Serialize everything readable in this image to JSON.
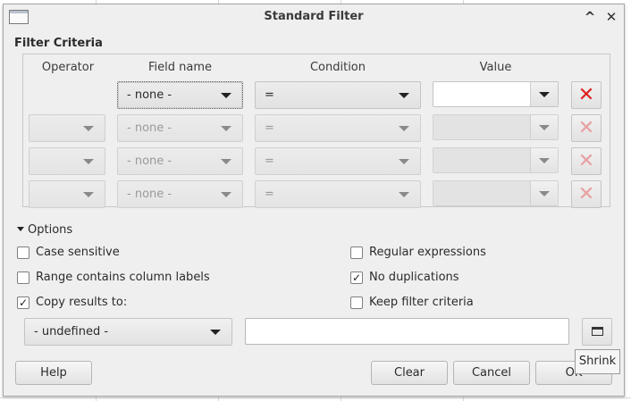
{
  "window": {
    "title": "Standard Filter",
    "collapse_glyph": "^",
    "close_glyph": "✕"
  },
  "criteria": {
    "section_label": "Filter Criteria",
    "headers": {
      "operator": "Operator",
      "field_name": "Field name",
      "condition": "Condition",
      "value": "Value"
    },
    "rows": [
      {
        "operator": "",
        "field": "- none -",
        "condition": "=",
        "value": "",
        "enabled": true
      },
      {
        "operator": "",
        "field": "- none -",
        "condition": "=",
        "value": "",
        "enabled": false
      },
      {
        "operator": "",
        "field": "- none -",
        "condition": "=",
        "value": "",
        "enabled": false
      },
      {
        "operator": "",
        "field": "- none -",
        "condition": "=",
        "value": "",
        "enabled": false
      }
    ],
    "delete_glyph": "✕"
  },
  "options": {
    "toggle_label": "Options",
    "case_sensitive": {
      "label": "Case sensitive",
      "checked": false
    },
    "regular_expressions": {
      "label": "Regular expressions",
      "checked": false
    },
    "range_contains_labels": {
      "label": "Range contains column labels",
      "checked": false
    },
    "no_duplications": {
      "label": "No duplications",
      "checked": true
    },
    "copy_results": {
      "label": "Copy results to:",
      "checked": true
    },
    "keep_filter": {
      "label": "Keep filter criteria",
      "checked": false
    },
    "destination_select": "- undefined -",
    "destination_input": "",
    "shrink_tooltip": "Shrink"
  },
  "buttons": {
    "help": "Help",
    "clear": "Clear",
    "cancel": "Cancel",
    "ok": "OK"
  },
  "colors": {
    "delete_red": "#e02020",
    "dialog_bg": "#efefef"
  }
}
